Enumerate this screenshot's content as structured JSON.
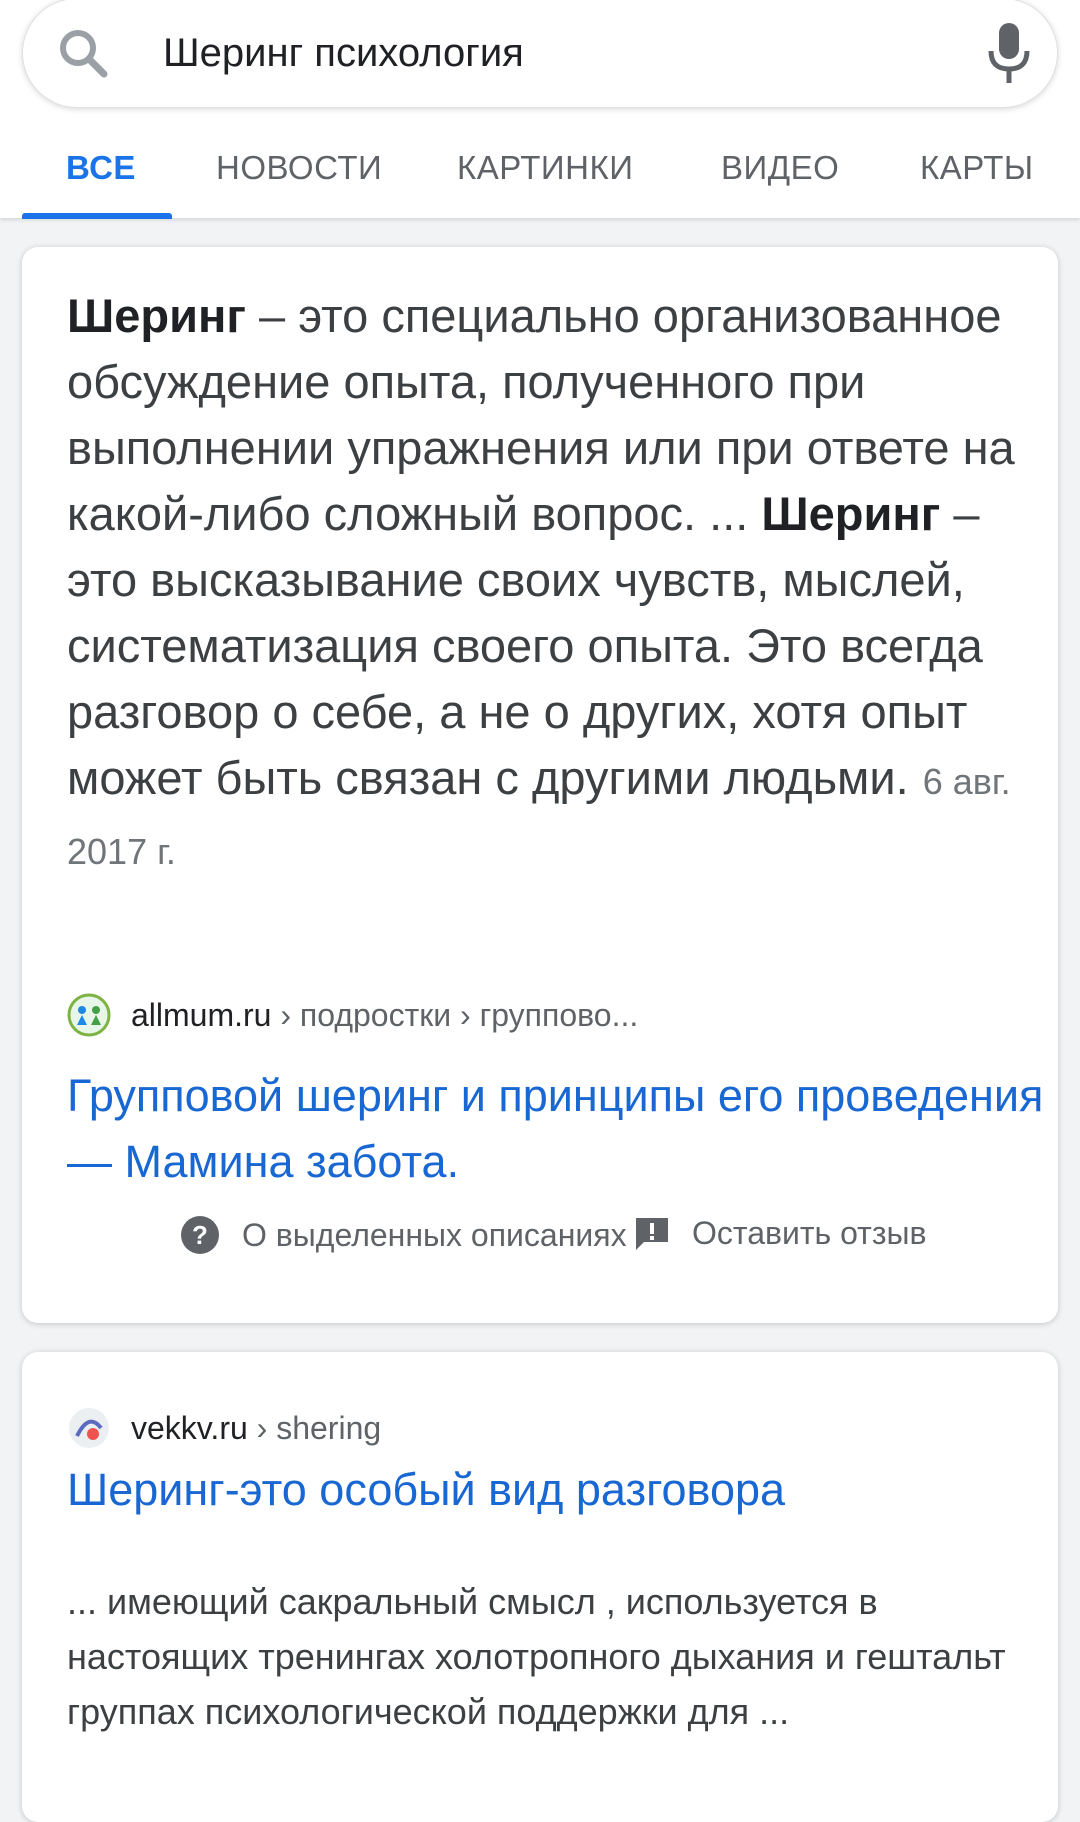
{
  "search": {
    "query": "Шеринг психология"
  },
  "tabs": [
    {
      "label": "ВСЕ",
      "active": true
    },
    {
      "label": "НОВОСТИ",
      "active": false
    },
    {
      "label": "КАРТИНКИ",
      "active": false
    },
    {
      "label": "ВИДЕО",
      "active": false
    },
    {
      "label": "КАРТЫ",
      "active": false
    }
  ],
  "featured_snippet": {
    "term1": "Шеринг",
    "text1": " – это специально организованное обсуждение опыта, полученного при выполнении упражнения или при ответе на какой-либо сложный вопрос. ... ",
    "term2": "Шеринг",
    "text2": " – это высказывание своих чувств, мыслей, систематизация своего опыта. Это всегда разговор о себе, а не о других, хотя опыт может быть связан с другими людьми.",
    "date": "6 авг. 2017 г.",
    "source": {
      "domain": "allmum.ru",
      "path": " › подростки › группово..."
    },
    "title": "Групповой шеринг и принципы его проведения — Мамина забота.",
    "about_label": "О выделенных описаниях",
    "feedback_label": "Оставить отзыв"
  },
  "result2": {
    "source": {
      "domain": "vekkv.ru",
      "path": " › shering"
    },
    "title": "Шеринг-это особый вид разговора",
    "description": "... имеющий сакральный смысл , используется в настоящих тренингах холотропного дыхания и гештальт группах психологической поддержки для ..."
  },
  "icons": {
    "search": "search-icon",
    "mic": "mic-icon",
    "help": "help-icon",
    "feedback": "feedback-icon"
  },
  "colors": {
    "accent": "#1a73e8",
    "link": "#1967d2",
    "text": "#3c4043",
    "muted": "#5f6368",
    "background": "#f1f3f4"
  }
}
